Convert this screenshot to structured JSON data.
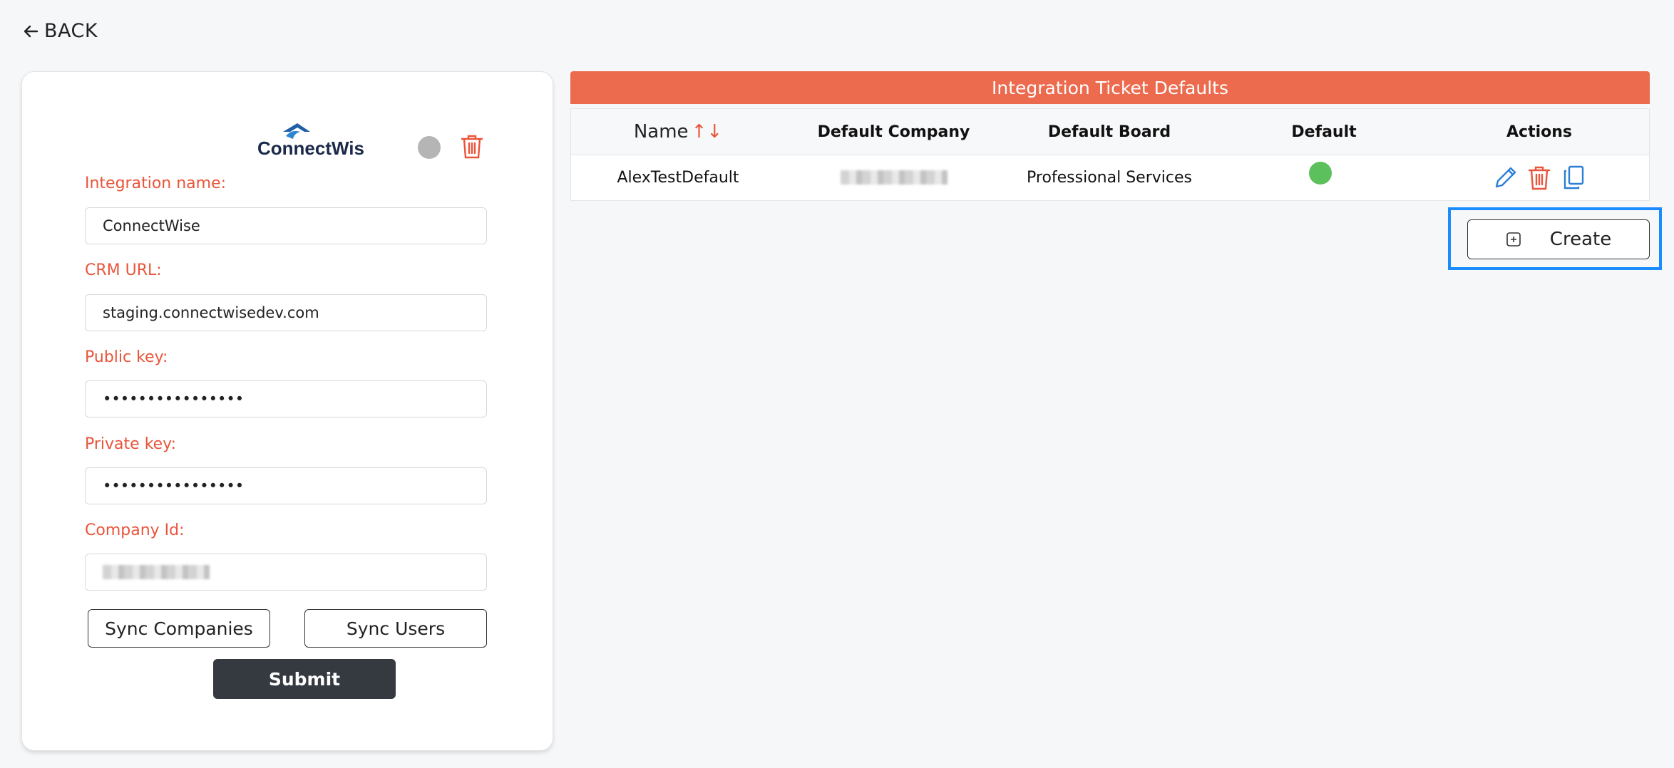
{
  "nav": {
    "back_label": "BACK"
  },
  "integration_card": {
    "logo_text": "ConnectWise",
    "fields": {
      "integration_name": {
        "label": "Integration name:",
        "value": "ConnectWise"
      },
      "crm_url": {
        "label": "CRM URL:",
        "value": "staging.connectwisedev.com"
      },
      "public_key": {
        "label": "Public key:",
        "value": "••••••••••••••••"
      },
      "private_key": {
        "label": "Private key:",
        "value": "••••••••••••••••"
      },
      "company_id": {
        "label": "Company Id:",
        "value": ""
      }
    },
    "sync_companies_label": "Sync Companies",
    "sync_users_label": "Sync Users",
    "submit_label": "Submit"
  },
  "ticket_defaults": {
    "title": "Integration Ticket Defaults",
    "columns": {
      "name": "Name",
      "default_company": "Default Company",
      "default_board": "Default Board",
      "default": "Default",
      "actions": "Actions"
    },
    "rows": [
      {
        "name": "AlexTestDefault",
        "default_company": "",
        "default_board": "Professional Services",
        "is_default": true
      }
    ],
    "create_label": "Create"
  },
  "colors": {
    "accent": "#ec6a4d",
    "label_red": "#e8553a",
    "default_green": "#5cc05c",
    "focus_blue": "#1a8cff",
    "submit_dark": "#353a40"
  }
}
